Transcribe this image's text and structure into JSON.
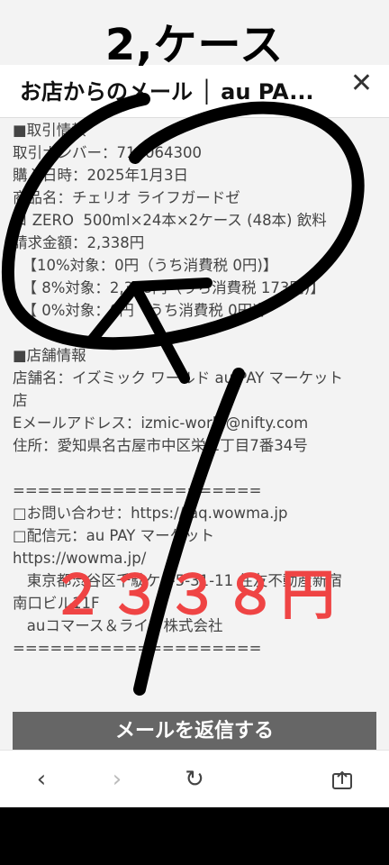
{
  "overlay_title": "2,ケース",
  "header": {
    "title": "お店からのメール │ au PA...",
    "close_glyph": "✕"
  },
  "content_lines": [
    "■取引情報",
    "取引ナンバー：719064300",
    "購入日時：2025年1月3日",
    "商品名：チェリオ ライフガードゼ",
    "ロ ZERO  500ml×24本×2ケース (48本) 飲料",
    "請求金額：2,338円",
    "  【10%対象：0円（うち消費税 0円)】",
    "  【 8%対象：2,338円（うち消費税 173円)】",
    "  【 0%対象：0円（うち消費税 0円)】",
    "",
    "■店舗情報",
    "店舗名：イズミック ワールド au PAY マーケット",
    "店",
    "Eメールアドレス：izmic-world@nifty.com",
    "住所：愛知県名古屋市中区栄 1丁目7番34号",
    "",
    "====================",
    "□お問い合わせ：https://faq.wowma.jp",
    "□配信元：au PAY マーケット",
    "https://wowma.jp/",
    "   東京都渋谷区千駄ケ谷5-31-11 住友不動産新宿",
    "南口ビル11F",
    "   auコマース＆ライフ株式会社",
    "===================="
  ],
  "annotation_amount": "２３３８円",
  "reply_button": "メールを返信する",
  "nav": {
    "back": "‹",
    "forward": "›",
    "reload": "↻",
    "share": "share-icon"
  },
  "colors": {
    "annotation_red": "#ef4444",
    "button_gray": "#666666"
  }
}
